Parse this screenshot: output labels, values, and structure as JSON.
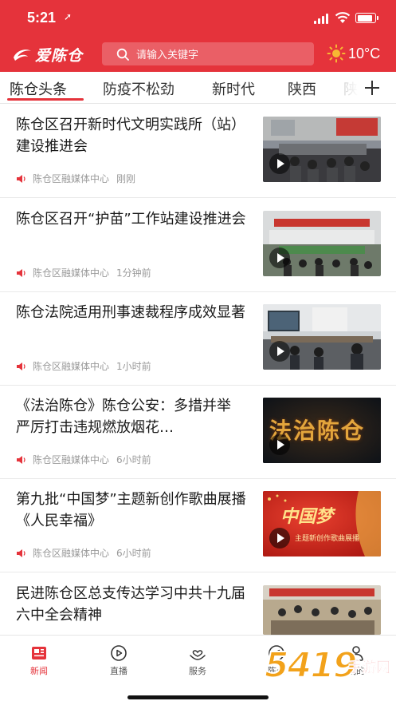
{
  "status_bar": {
    "time": "5:21",
    "location_arrow": "➚"
  },
  "header": {
    "logo_text": "爱陈仓",
    "search_placeholder": "请输入关键字",
    "temperature": "10°C"
  },
  "tabs": [
    {
      "label": "陈仓头条",
      "active": true
    },
    {
      "label": "防疫不松劲",
      "active": false
    },
    {
      "label": "新时代",
      "active": false
    },
    {
      "label": "陕西",
      "active": false
    },
    {
      "label": "陕",
      "active": false
    }
  ],
  "news": [
    {
      "title": "陈仓区召开新时代文明实践所（站）建设推进会",
      "source": "陈仓区融媒体中心",
      "time": "刚刚",
      "thumb": "meeting-room"
    },
    {
      "title": "陈仓区召开“护苗”工作站建设推进会",
      "source": "陈仓区融媒体中心",
      "time": "1分钟前",
      "thumb": "conference-hall"
    },
    {
      "title": "陈仓法院适用刑事速裁程序成效显著",
      "source": "陈仓区融媒体中心",
      "time": "1小时前",
      "thumb": "courtroom"
    },
    {
      "title": "《法治陈仓》陈仓公安：多措并举 严厉打击违规燃放烟花…",
      "source": "陈仓区融媒体中心",
      "time": "6小时前",
      "thumb": "program-title",
      "thumb_text": "法治陈仓"
    },
    {
      "title": "第九批“中国梦”主题新创作歌曲展播《人民幸福》",
      "source": "陈仓区融媒体中心",
      "time": "6小时前",
      "thumb": "song-banner",
      "thumb_text": "中国梦",
      "thumb_subtext": "主题新创作歌曲展播"
    },
    {
      "title": "民进陈仓区总支传达学习中共十九届六中全会精神",
      "source": "",
      "time": "",
      "thumb": "study-meeting"
    }
  ],
  "bottom_nav": [
    {
      "label": "新闻",
      "icon": "newspaper-icon",
      "active": true
    },
    {
      "label": "直播",
      "icon": "live-play-icon",
      "active": false
    },
    {
      "label": "服务",
      "icon": "heart-hand-icon",
      "active": false
    },
    {
      "label": "陈仓",
      "icon": "compass-icon",
      "active": false
    },
    {
      "label": "我的",
      "icon": "user-icon",
      "active": false
    }
  ],
  "watermark": {
    "text": "手游网",
    "number": "5419"
  },
  "colors": {
    "brand_red": "#e5333b",
    "meta_gray": "#9a9a9a"
  }
}
